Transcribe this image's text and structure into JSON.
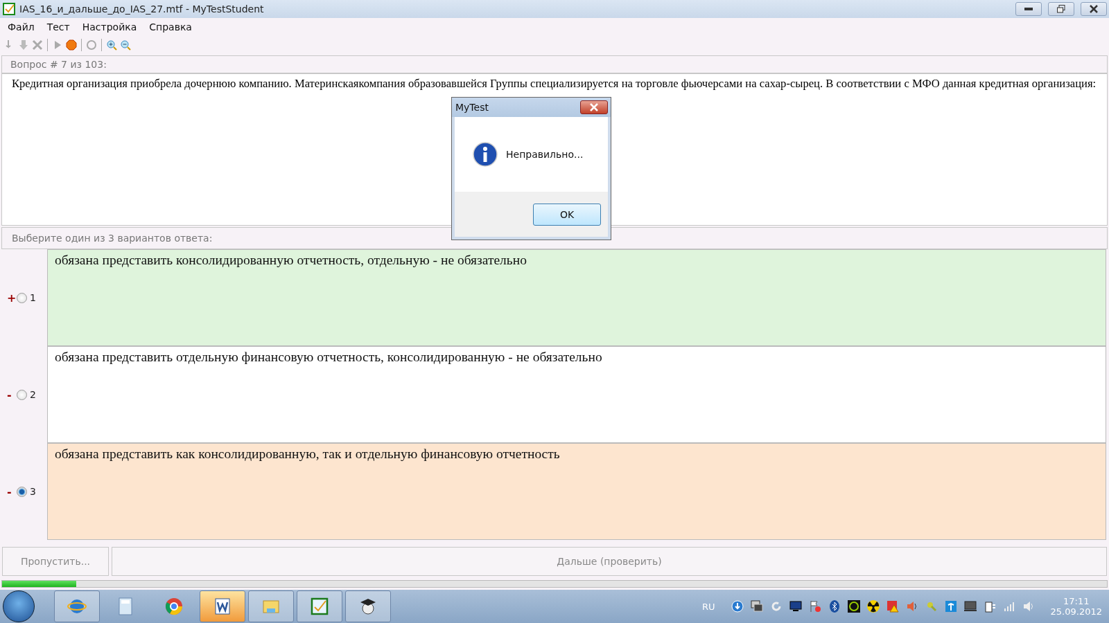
{
  "window": {
    "title": "IAS_16_и_дальше_до_IAS_27.mtf - MyTestStudent"
  },
  "menu": [
    "Файл",
    "Тест",
    "Настройка",
    "Справка"
  ],
  "question": {
    "header": "Вопрос # 7 из 103:",
    "text": "Кредитная организация приобрела дочернюю компанию. Материнскаякомпания образовавшейся Группы специализируется на торговле фьючерсами на сахар-сырец. В соответствии с МФО данная кредитная организация:"
  },
  "answers_header": "Выберите один из 3 вариантов ответа:",
  "answers": [
    {
      "mark": "+",
      "number": "1",
      "selected": false,
      "color": "#dff4dc",
      "text": "обязана представить консолидированную отчетность, отдельную - не обязательно"
    },
    {
      "mark": "-",
      "number": "2",
      "selected": false,
      "color": "#ffffff",
      "text": "обязана представить отдельную финансовую отчетность, консолидированную - не обязательно"
    },
    {
      "mark": "-",
      "number": "3",
      "selected": true,
      "color": "#fde5cf",
      "text": "обязана представить как консолидированную, так и отдельную финансовую отчетность"
    }
  ],
  "buttons": {
    "skip": "Пропустить...",
    "next": "Дальше (проверить)"
  },
  "progress": {
    "level": 0.067
  },
  "dialog": {
    "title": "MyTest",
    "message": "Неправильно...",
    "ok": "OK"
  },
  "taskbar": {
    "language": "RU",
    "time": "17:11",
    "date": "25.09.2012"
  }
}
